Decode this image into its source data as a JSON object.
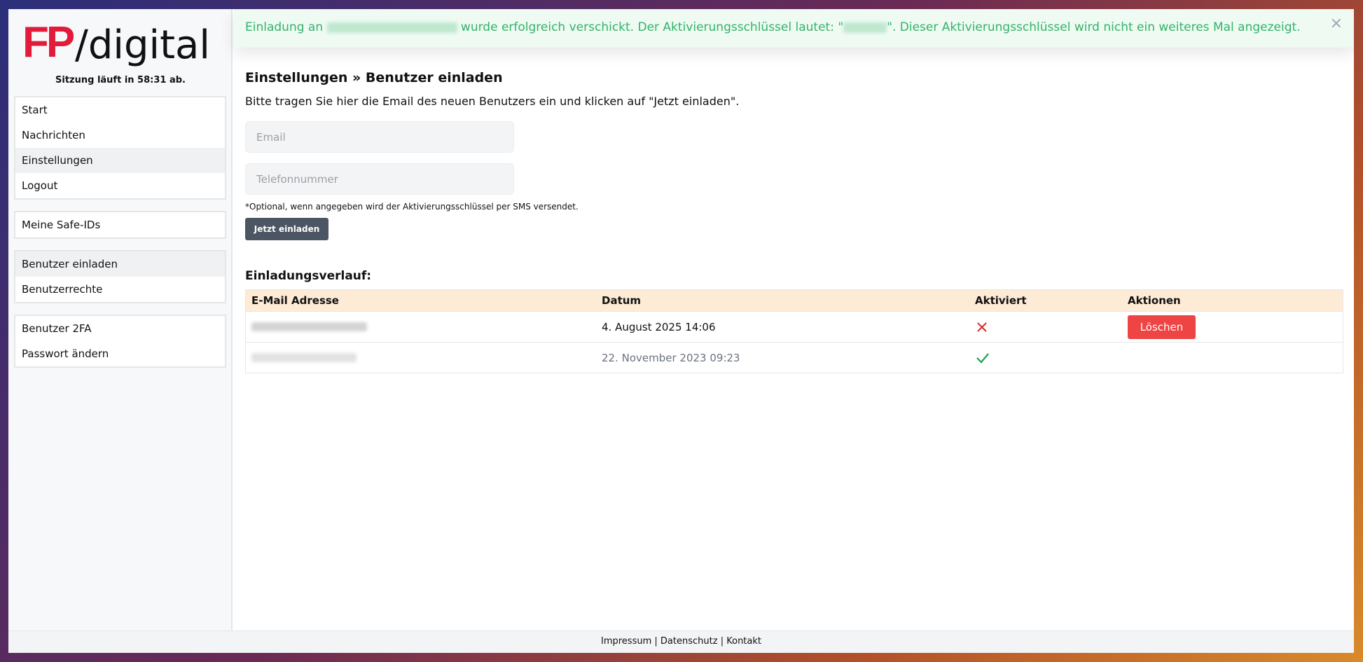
{
  "brand": {
    "logo_mark": "FP",
    "logo_text": "/digital"
  },
  "session": {
    "text": "Sitzung läuft in 58:31 ab."
  },
  "sidebar": {
    "group1": [
      {
        "label": "Start"
      },
      {
        "label": "Nachrichten"
      },
      {
        "label": "Einstellungen"
      },
      {
        "label": "Logout"
      }
    ],
    "group2": [
      {
        "label": "Meine Safe-IDs"
      }
    ],
    "group3": [
      {
        "label": "Benutzer einladen"
      },
      {
        "label": "Benutzerrechte"
      }
    ],
    "group4": [
      {
        "label": "Benutzer 2FA"
      },
      {
        "label": "Passwort ändern"
      }
    ]
  },
  "alert": {
    "prefix": "Einladung an",
    "middle": "wurde erfolgreich verschickt. Der Aktivierungsschlüssel lautet: \"",
    "suffix": "\". Dieser Aktivierungsschlüssel wird nicht ein weiteres Mal angezeigt.",
    "close_icon": "close-icon"
  },
  "page": {
    "heading": "Einstellungen » Benutzer einladen",
    "intro": "Bitte tragen Sie hier die Email des neuen Benutzers ein und klicken auf \"Jetzt einladen\"."
  },
  "form": {
    "email_placeholder": "Email",
    "phone_placeholder": "Telefonnummer",
    "hint": "*Optional, wenn angegeben wird der Aktivierungsschlüssel per SMS versendet.",
    "submit_label": "Jetzt einladen"
  },
  "history": {
    "title": "Einladungsverlauf:",
    "columns": [
      "E-Mail Adresse",
      "Datum",
      "Aktiviert",
      "Aktionen"
    ],
    "rows": [
      {
        "date": "4. August 2025 14:06",
        "activated": false,
        "action": "Löschen"
      },
      {
        "date": "22. November 2023 09:23",
        "activated": true,
        "action": ""
      }
    ]
  },
  "footer": {
    "impressum": "Impressum",
    "datenschutz": "Datenschutz",
    "kontakt": "Kontakt",
    "separator": "|"
  },
  "colors": {
    "brand_red": "#e31b3b",
    "success_green": "#34b36a",
    "danger_red": "#ef4444",
    "table_header": "#fdebd6"
  }
}
